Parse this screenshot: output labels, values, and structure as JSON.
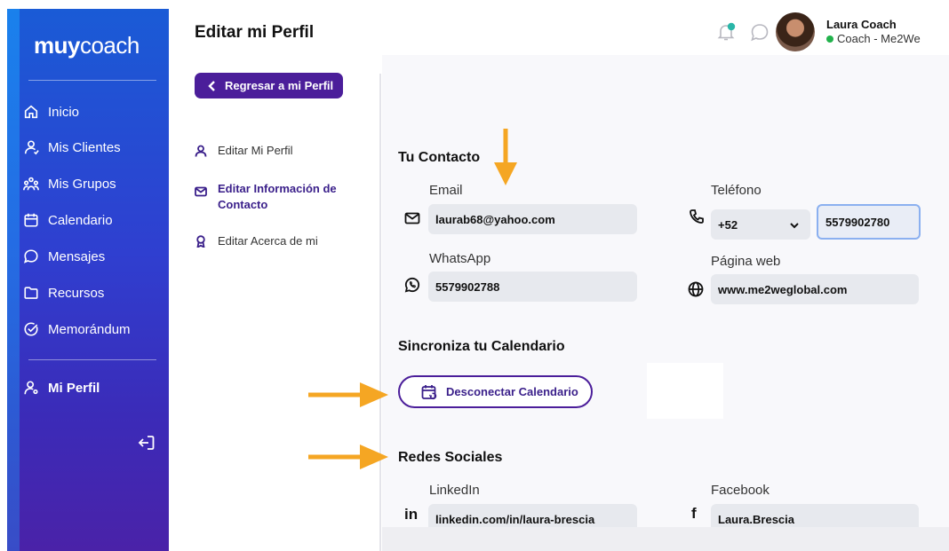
{
  "colors": {
    "accent": "#4b1e9a",
    "arrow": "#f5a623",
    "online": "#22b24c"
  },
  "sidebar": {
    "logo_bold": "muy",
    "logo_light": "coach",
    "items": [
      {
        "label": "Inicio",
        "icon": "home-icon"
      },
      {
        "label": "Mis Clientes",
        "icon": "user-icon"
      },
      {
        "label": "Mis Grupos",
        "icon": "group-icon"
      },
      {
        "label": "Calendario",
        "icon": "calendar-icon"
      },
      {
        "label": "Mensajes",
        "icon": "chat-icon"
      },
      {
        "label": "Recursos",
        "icon": "folder-icon"
      },
      {
        "label": "Memorándum",
        "icon": "check-circle-icon"
      }
    ],
    "profile_label": "Mi Perfil",
    "logout_icon": "logout-icon"
  },
  "header": {
    "title": "Editar mi Perfil",
    "user_name": "Laura Coach",
    "user_role": "Coach - Me2We"
  },
  "back_button": "Regresar a mi Perfil",
  "subnav": {
    "edit_profile": "Editar Mi Perfil",
    "edit_contact": "Editar Información de Contacto",
    "edit_about": "Editar Acerca de mi"
  },
  "contact": {
    "title": "Tu Contacto",
    "email_label": "Email",
    "email_value": "laurab68@yahoo.com",
    "phone_label": "Teléfono",
    "phone_code": "+52",
    "phone_value": "5579902780",
    "whatsapp_label": "WhatsApp",
    "whatsapp_value": "5579902788",
    "web_label": "Página web",
    "web_value": "www.me2weglobal.com"
  },
  "calendar": {
    "title": "Sincroniza tu Calendario",
    "button": "Desconectar Calendario"
  },
  "social": {
    "title": "Redes Sociales",
    "linkedin_label": "LinkedIn",
    "linkedin_icon_text": "in",
    "linkedin_value": "linkedin.com/in/laura-brescia",
    "facebook_label": "Facebook",
    "facebook_icon_text": "f",
    "facebook_value": "Laura.Brescia"
  }
}
